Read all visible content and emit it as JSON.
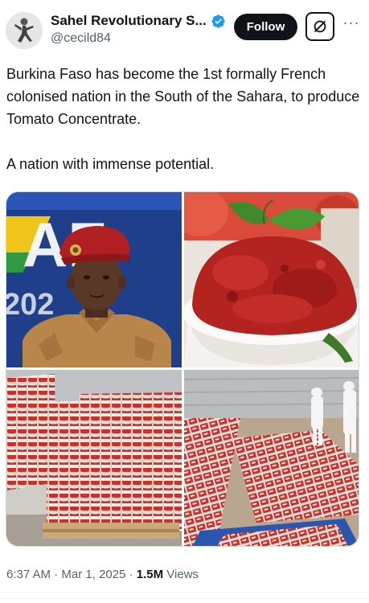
{
  "author": {
    "display_name": "Sahel Revolutionary S...",
    "handle": "@cecild84",
    "verified_icon": "verified-badge-icon"
  },
  "actions": {
    "follow_label": "Follow",
    "grok_icon": "grok-icon",
    "more_icon": "more-dots-icon",
    "more_glyph": "···"
  },
  "tweet": {
    "paragraph_1": "Burkina Faso has become the 1st formally French colonised nation in the South of the Sahara, to produce Tomato Concentrate.",
    "paragraph_2": "A nation with immense potential."
  },
  "media": {
    "photo_1_banner_text": "AF",
    "photo_1_year_text": "202"
  },
  "meta": {
    "time": "6:37 AM",
    "separator": " · ",
    "date": "Mar 1, 2025",
    "views_count": "1.5M",
    "views_label": " Views"
  },
  "colors": {
    "follow_bg": "#0f1419",
    "verified_blue": "#1d9bf0",
    "secondary_text": "#536471",
    "border": "#cfd9de"
  }
}
